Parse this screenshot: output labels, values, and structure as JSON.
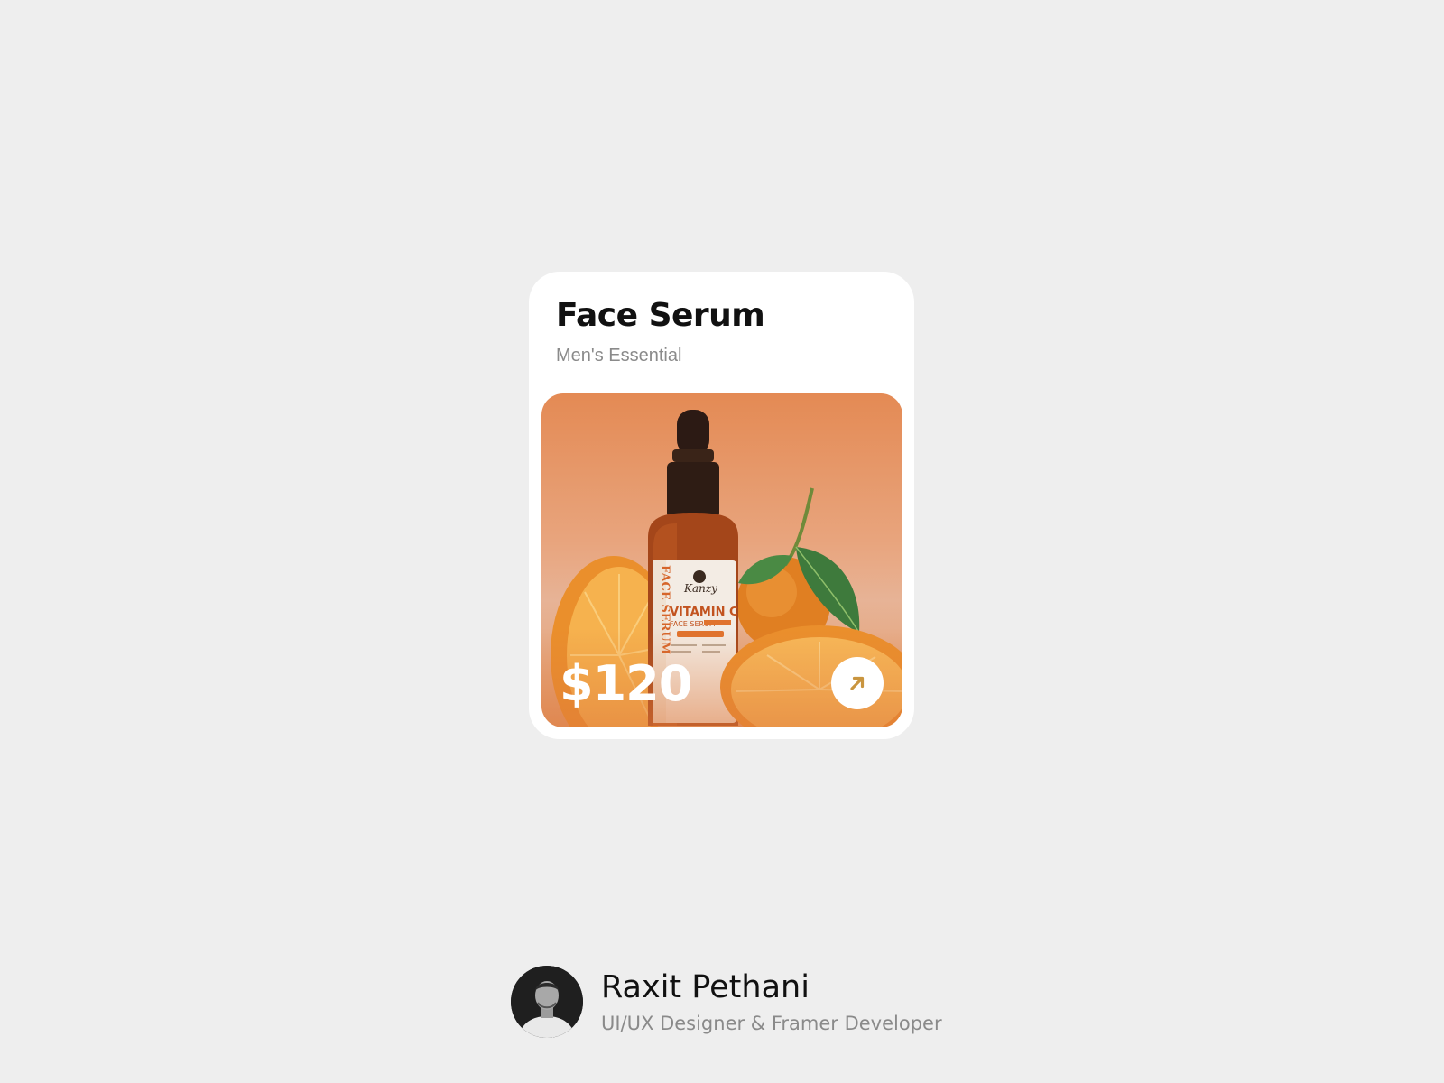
{
  "product": {
    "title": "Face Serum",
    "subtitle": "Men's Essential",
    "price": "$120",
    "image": {
      "bottle_label_side": "FACE SERUM",
      "bottle_brand": "Kanzy",
      "bottle_label_main": "VITAMIN C",
      "bottle_label_sub": "FACE SERUM"
    },
    "action_icon": "arrow-up-right-icon",
    "accent_color": "#e48a54",
    "button_icon_color": "#c9953f"
  },
  "author": {
    "name": "Raxit Pethani",
    "role": "UI/UX Designer & Framer Developer",
    "avatar_icon": "person-portrait-icon"
  }
}
